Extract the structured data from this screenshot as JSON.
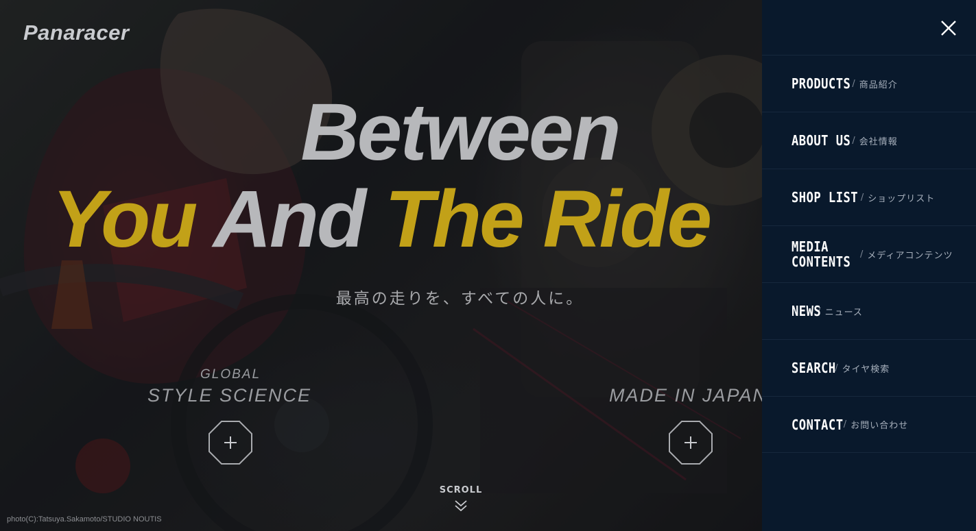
{
  "brand": {
    "logo_text": "Panaracer"
  },
  "hero": {
    "headline_line1": "Between",
    "headline_line2_part1": "You",
    "headline_line2_part2": "And",
    "headline_line2_part3": "The Ride",
    "tagline": "最高の走りを、すべての人に。",
    "features": [
      {
        "small": "GLOBAL",
        "big": "STYLE SCIENCE"
      },
      {
        "small": "",
        "big": "MADE IN JAPAN"
      }
    ],
    "scroll_label": "SCROLL",
    "photo_credit": "photo(C):Tatsuya.Sakamoto/STUDIO NOUTIS",
    "colors": {
      "gold": "#c2a118",
      "grey": "#b7b8bb"
    }
  },
  "menu": {
    "background": "#09192c",
    "close_icon": "close-icon",
    "separator": "/",
    "items": [
      {
        "en": "PRODUCTS",
        "jp": "商品紹介"
      },
      {
        "en": "ABOUT US",
        "jp": "会社情報"
      },
      {
        "en": "SHOP LIST",
        "jp": "ショップリスト"
      },
      {
        "en": "MEDIA CONTENTS",
        "en_line1": "MEDIA",
        "en_line2": "CONTENTS",
        "jp": "メディアコンテンツ"
      },
      {
        "en": "NEWS",
        "jp": "ニュース"
      },
      {
        "en": "SEARCH",
        "jp": "タイヤ検索"
      },
      {
        "en": "CONTACT",
        "jp": "お問い合わせ"
      }
    ]
  }
}
